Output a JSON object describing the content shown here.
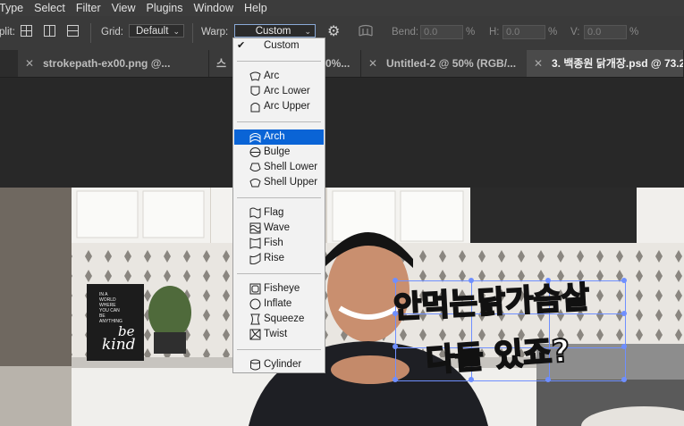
{
  "menubar": {
    "items": [
      "Type",
      "Select",
      "Filter",
      "View",
      "Plugins",
      "Window",
      "Help"
    ]
  },
  "options": {
    "split_label": "plit:",
    "grid_label": "Grid:",
    "grid_value": "Default",
    "warp_label": "Warp:",
    "warp_value": "Custom",
    "bend_label": "Bend:",
    "bend_value": "0.0",
    "h_label": "H:",
    "h_value": "0.0",
    "v_label": "V:",
    "v_value": "0.0",
    "percent": "%"
  },
  "tabs": [
    {
      "label": "strokepath-ex00.png @..."
    },
    {
      "label": "스"
    },
    {
      "label": "0%..."
    },
    {
      "label": "Untitled-2 @ 50% (RGB/..."
    },
    {
      "label": "3. 백종원 닭개장.psd @ 73.2"
    }
  ],
  "warp_menu": {
    "checked": "Custom",
    "highlighted": "Arch",
    "items": [
      {
        "label": "Custom",
        "icon": "none",
        "group": 0
      },
      {
        "label": "Arc",
        "icon": "arc-icon",
        "group": 1
      },
      {
        "label": "Arc Lower",
        "icon": "arc-lower-icon",
        "group": 1
      },
      {
        "label": "Arc Upper",
        "icon": "arc-upper-icon",
        "group": 1
      },
      {
        "label": "Arch",
        "icon": "arch-icon",
        "group": 2
      },
      {
        "label": "Bulge",
        "icon": "bulge-icon",
        "group": 2
      },
      {
        "label": "Shell Lower",
        "icon": "shell-lower-icon",
        "group": 2
      },
      {
        "label": "Shell Upper",
        "icon": "shell-upper-icon",
        "group": 2
      },
      {
        "label": "Flag",
        "icon": "flag-icon",
        "group": 3
      },
      {
        "label": "Wave",
        "icon": "wave-icon",
        "group": 3
      },
      {
        "label": "Fish",
        "icon": "fish-icon",
        "group": 3
      },
      {
        "label": "Rise",
        "icon": "rise-icon",
        "group": 3
      },
      {
        "label": "Fisheye",
        "icon": "fisheye-icon",
        "group": 4
      },
      {
        "label": "Inflate",
        "icon": "inflate-icon",
        "group": 4
      },
      {
        "label": "Squeeze",
        "icon": "squeeze-icon",
        "group": 4
      },
      {
        "label": "Twist",
        "icon": "twist-icon",
        "group": 4
      },
      {
        "label": "Cylinder",
        "icon": "cylinder-icon",
        "group": 5
      }
    ]
  },
  "canvas": {
    "caption_line1": "안먹는닭가슴살",
    "caption_line2": "다들 있죠?",
    "sign_lines": [
      "IN A",
      "WORLD",
      "WHERE",
      "YOU CAN",
      "BE",
      "ANYTHING"
    ],
    "sign_script1": "be",
    "sign_script2": "kind"
  },
  "colors": {
    "highlight": "#0a64d6",
    "selection_box": "#6f8fff"
  }
}
